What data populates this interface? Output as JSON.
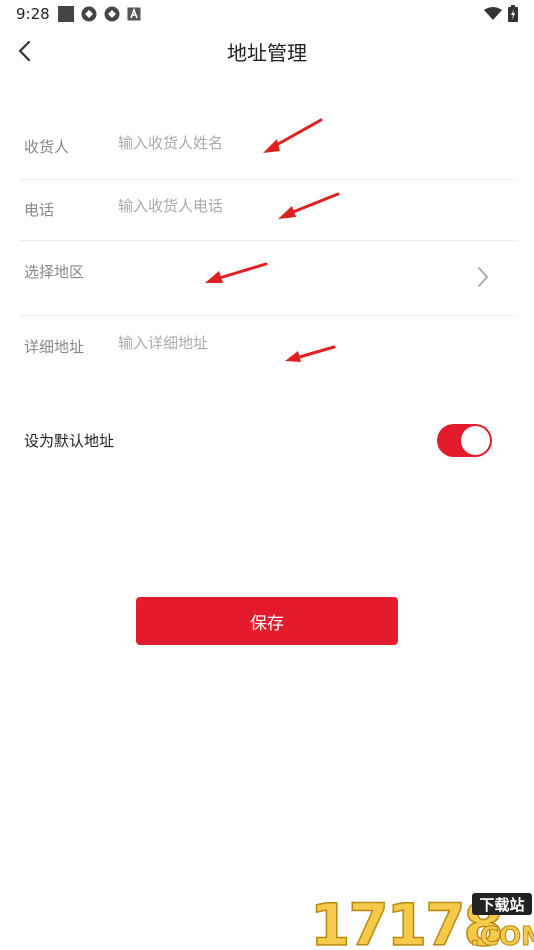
{
  "status_bar": {
    "time": "9:28",
    "left_icons": [
      "square-notification-icon",
      "app-icon",
      "app-icon",
      "a-icon"
    ],
    "right_icons": [
      "wifi-icon",
      "battery-icon"
    ]
  },
  "header": {
    "title": "地址管理",
    "back_icon": "chevron-left-icon"
  },
  "form": {
    "recipient": {
      "label": "收货人",
      "placeholder": "输入收货人姓名",
      "value": ""
    },
    "phone": {
      "label": "电话",
      "placeholder": "输入收货人电话",
      "value": ""
    },
    "region": {
      "label": "选择地区",
      "chevron": "chevron-right-icon"
    },
    "address": {
      "label": "详细地址",
      "placeholder": "输入详细地址",
      "value": ""
    }
  },
  "default_address": {
    "label": "设为默认地址",
    "enabled": true
  },
  "save": {
    "label": "保存"
  },
  "watermark": {
    "brand": "17178",
    "tag": "下载站",
    "suffix": ".COM"
  },
  "colors": {
    "accent": "#e41b2c",
    "arrow": "#e02020",
    "label": "#888888",
    "placeholder": "#aaaaaa",
    "divider": "#efefef"
  }
}
